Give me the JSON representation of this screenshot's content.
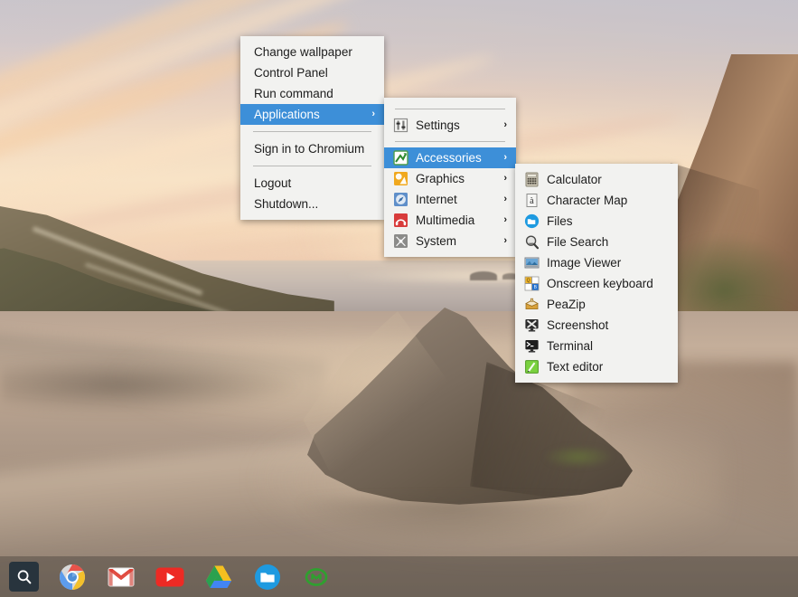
{
  "desktop": {
    "wallpaper_description": "Sunset beach with a large rock, wet sand reflections and cliffs",
    "colors": {
      "menu_background": "#f2f2f0",
      "menu_highlight": "#3d8fd8",
      "menu_text": "#1d1d1d",
      "menu_highlight_text": "#ffffff",
      "separator": "#b9b9b7",
      "taskbar_background": "rgba(34,32,30,0.30)",
      "search_button": "#28343d"
    }
  },
  "root_menu": {
    "name": "desktop-context-menu",
    "items": [
      {
        "label": "Change wallpaper",
        "type": "item",
        "has_submenu": false,
        "selected": false
      },
      {
        "label": "Control Panel",
        "type": "item",
        "has_submenu": false,
        "selected": false
      },
      {
        "label": "Run command",
        "type": "item",
        "has_submenu": false,
        "selected": false
      },
      {
        "label": "Applications",
        "type": "item",
        "has_submenu": true,
        "selected": true,
        "arrow": "›"
      },
      {
        "type": "separator"
      },
      {
        "label": "Sign in to Chromium",
        "type": "item",
        "has_submenu": false,
        "selected": false
      },
      {
        "type": "separator"
      },
      {
        "label": "Logout",
        "type": "item",
        "has_submenu": false,
        "selected": false
      },
      {
        "label": "Shutdown...",
        "type": "item",
        "has_submenu": false,
        "selected": false
      }
    ]
  },
  "applications_menu": {
    "name": "applications-submenu",
    "items": [
      {
        "type": "separator"
      },
      {
        "label": "Settings",
        "icon": "settings-sliders-icon",
        "has_submenu": true,
        "selected": false,
        "arrow": "›"
      },
      {
        "type": "separator"
      },
      {
        "label": "Accessories",
        "icon": "accessories-icon",
        "has_submenu": true,
        "selected": true,
        "arrow": "›"
      },
      {
        "label": "Graphics",
        "icon": "graphics-icon",
        "has_submenu": true,
        "selected": false,
        "arrow": "›"
      },
      {
        "label": "Internet",
        "icon": "internet-icon",
        "has_submenu": true,
        "selected": false,
        "arrow": "›"
      },
      {
        "label": "Multimedia",
        "icon": "multimedia-icon",
        "has_submenu": true,
        "selected": false,
        "arrow": "›"
      },
      {
        "label": "System",
        "icon": "system-icon",
        "has_submenu": true,
        "selected": false,
        "arrow": "›"
      }
    ]
  },
  "accessories_menu": {
    "name": "accessories-submenu",
    "items": [
      {
        "label": "Calculator",
        "icon": "calculator-icon"
      },
      {
        "label": "Character Map",
        "icon": "character-map-icon"
      },
      {
        "label": "Files",
        "icon": "files-folder-icon"
      },
      {
        "label": "File Search",
        "icon": "file-search-icon"
      },
      {
        "label": "Image Viewer",
        "icon": "image-viewer-icon"
      },
      {
        "label": "Onscreen keyboard",
        "icon": "onscreen-keyboard-icon"
      },
      {
        "label": "PeaZip",
        "icon": "peazip-icon"
      },
      {
        "label": "Screenshot",
        "icon": "screenshot-icon"
      },
      {
        "label": "Terminal",
        "icon": "terminal-icon"
      },
      {
        "label": "Text editor",
        "icon": "text-editor-icon"
      }
    ]
  },
  "taskbar": {
    "search_label": "Search",
    "items": [
      {
        "name": "chrome-icon",
        "label": "Chromium"
      },
      {
        "name": "gmail-icon",
        "label": "Gmail"
      },
      {
        "name": "youtube-icon",
        "label": "YouTube"
      },
      {
        "name": "google-drive-icon",
        "label": "Google Drive"
      },
      {
        "name": "files-icon",
        "label": "Files"
      },
      {
        "name": "recycle-icon",
        "label": "Recycle"
      }
    ]
  }
}
